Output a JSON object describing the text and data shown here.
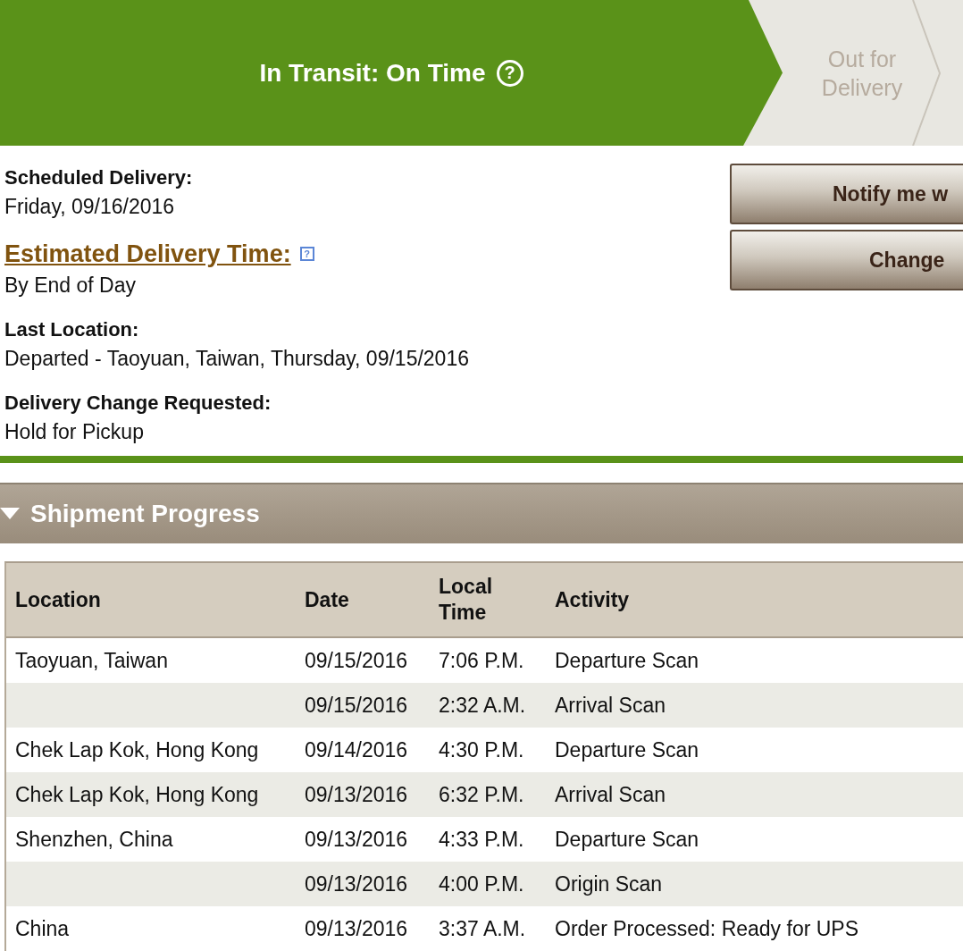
{
  "progress_steps": [
    {
      "label": "In Transit: On Time",
      "help": "?",
      "current": true
    },
    {
      "label": "Out for Delivery",
      "current": false
    }
  ],
  "details": [
    {
      "label": "Scheduled Delivery:",
      "value": "Friday, 09/16/2016",
      "kind": "plain"
    },
    {
      "label": "Estimated Delivery Time:",
      "value": "By End of Day",
      "kind": "link",
      "help": "?"
    },
    {
      "label": "Last Location:",
      "value": "Departed - Taoyuan, Taiwan, Thursday, 09/15/2016",
      "kind": "plain"
    },
    {
      "label": "Delivery Change Requested:",
      "value": "Hold for Pickup",
      "kind": "plain"
    }
  ],
  "actions": [
    "Notify me w",
    "Change"
  ],
  "shipment_progress": {
    "title": "Shipment Progress",
    "expanded": true,
    "columns": [
      "Location",
      "Date",
      "Local Time",
      "Activity"
    ],
    "rows": [
      [
        "Taoyuan, Taiwan",
        "09/15/2016",
        "7:06 P.M.",
        "Departure Scan"
      ],
      [
        "",
        "09/15/2016",
        "2:32 A.M.",
        "Arrival Scan"
      ],
      [
        "Chek Lap Kok, Hong Kong",
        "09/14/2016",
        "4:30 P.M.",
        "Departure Scan"
      ],
      [
        "Chek Lap Kok, Hong Kong",
        "09/13/2016",
        "6:32 P.M.",
        "Arrival Scan"
      ],
      [
        "Shenzhen, China",
        "09/13/2016",
        "4:33 P.M.",
        "Departure Scan"
      ],
      [
        "",
        "09/13/2016",
        "4:00 P.M.",
        "Origin Scan"
      ],
      [
        "China",
        "09/13/2016",
        "3:37 A.M.",
        "Order Processed: Ready for UPS"
      ]
    ]
  }
}
